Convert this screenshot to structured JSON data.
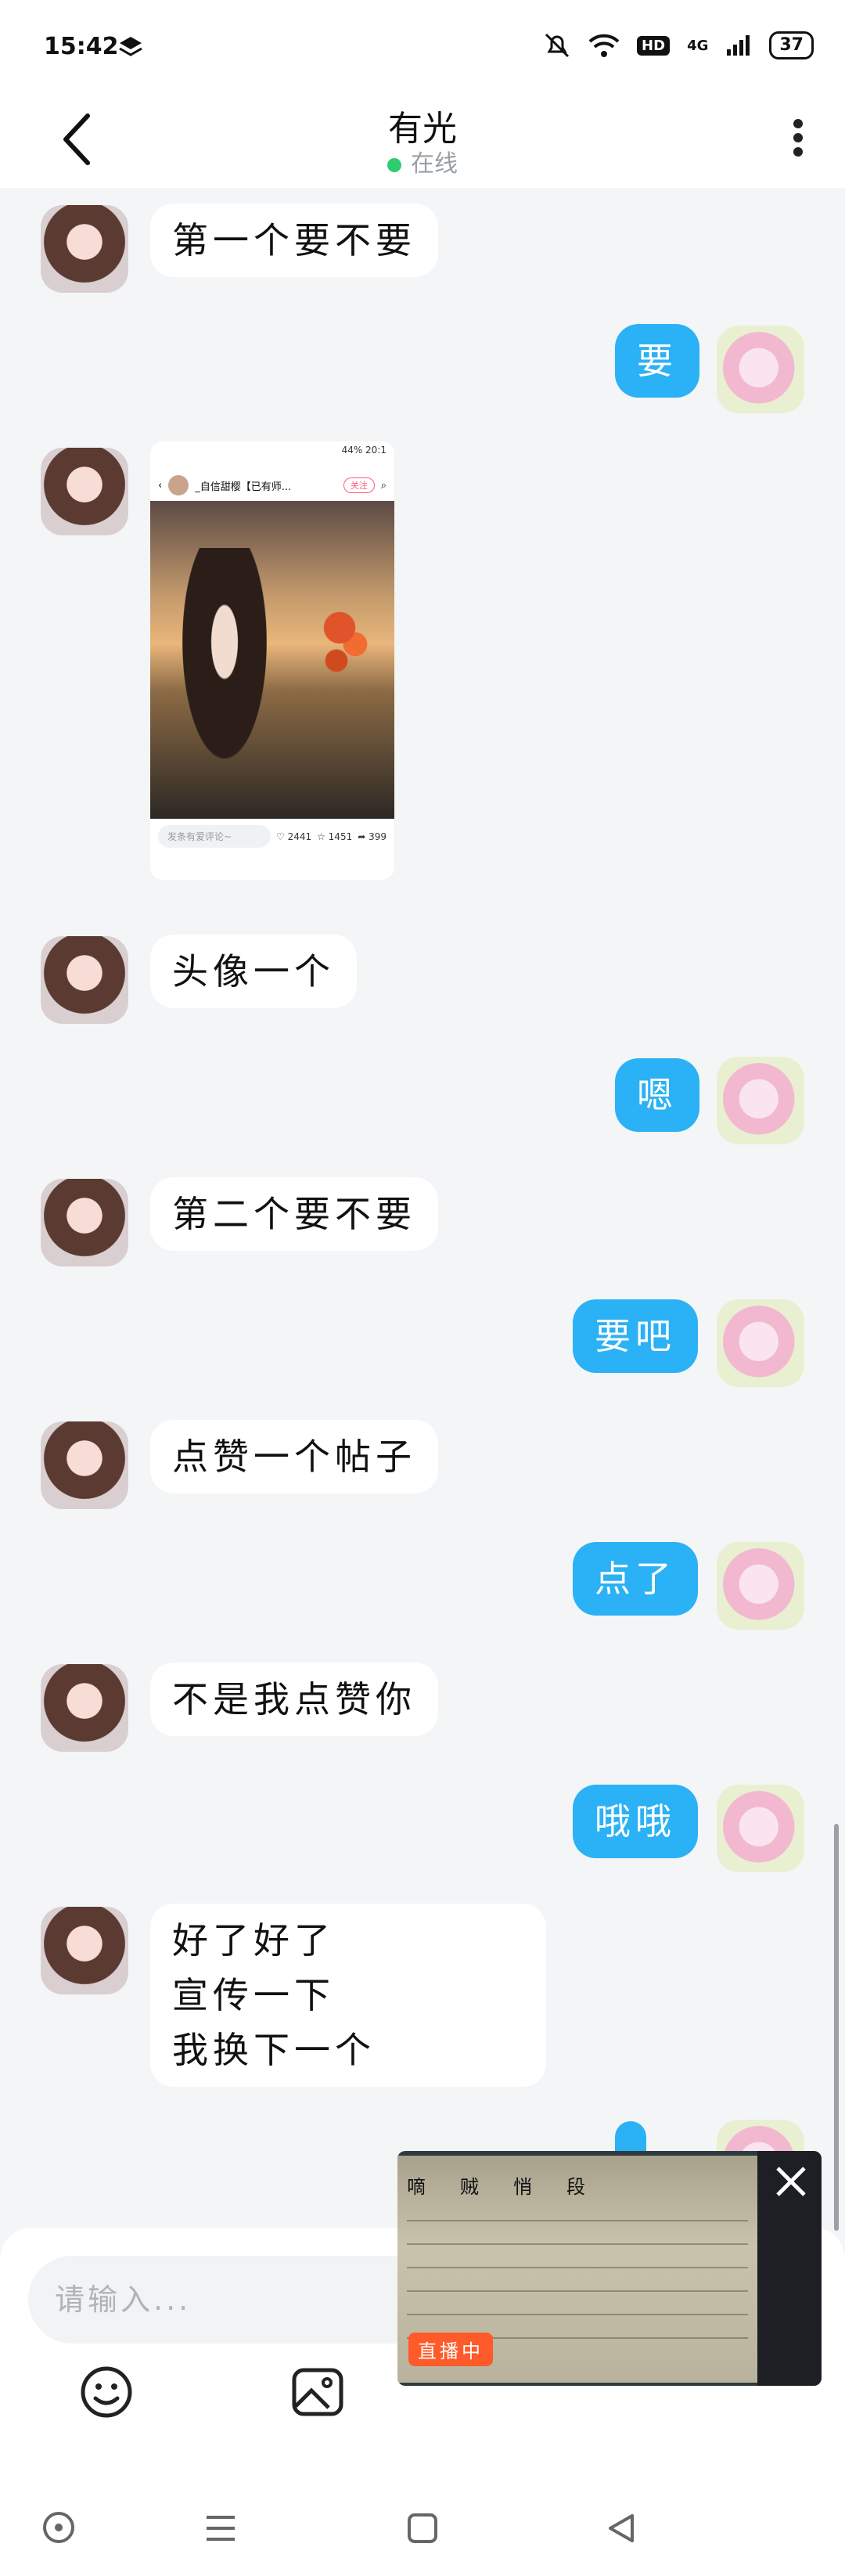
{
  "status_bar": {
    "time": "15:42",
    "network": "4G",
    "hd": "HD",
    "battery": "37"
  },
  "header": {
    "title": "有光",
    "presence": "在线"
  },
  "messages": [
    {
      "side": "in",
      "text": "第一个要不要"
    },
    {
      "side": "out",
      "text": "要"
    },
    {
      "side": "in",
      "type": "post"
    },
    {
      "side": "in",
      "text": "头像一个"
    },
    {
      "side": "out",
      "text": "嗯"
    },
    {
      "side": "in",
      "text": "第二个要不要"
    },
    {
      "side": "out",
      "text": "要吧"
    },
    {
      "side": "in",
      "text": "点赞一个帖子"
    },
    {
      "side": "out",
      "text": "点了"
    },
    {
      "side": "in",
      "text": "不是我点赞你"
    },
    {
      "side": "out",
      "text": "哦哦"
    },
    {
      "side": "in",
      "lines": [
        "好了好了",
        "宣传一下",
        "我换下一个"
      ]
    }
  ],
  "shared_post": {
    "status": "44% 20:1",
    "author": "_自信甜樱【已有师...",
    "follow_label": "关注",
    "comment_placeholder": "发条有爱评论~",
    "likes": "2441",
    "favorites": "1451",
    "shares": "399"
  },
  "floating_window": {
    "live_badge": "直播中",
    "doc_labels": [
      "嘀",
      "贼",
      "悄",
      "段"
    ]
  },
  "composer": {
    "placeholder": "请输入..."
  },
  "colors": {
    "outgoing_bubble": "#2bb1f5",
    "incoming_bubble": "#ffffff",
    "online_dot": "#2ecc71",
    "live_badge": "#ff5a2a"
  }
}
